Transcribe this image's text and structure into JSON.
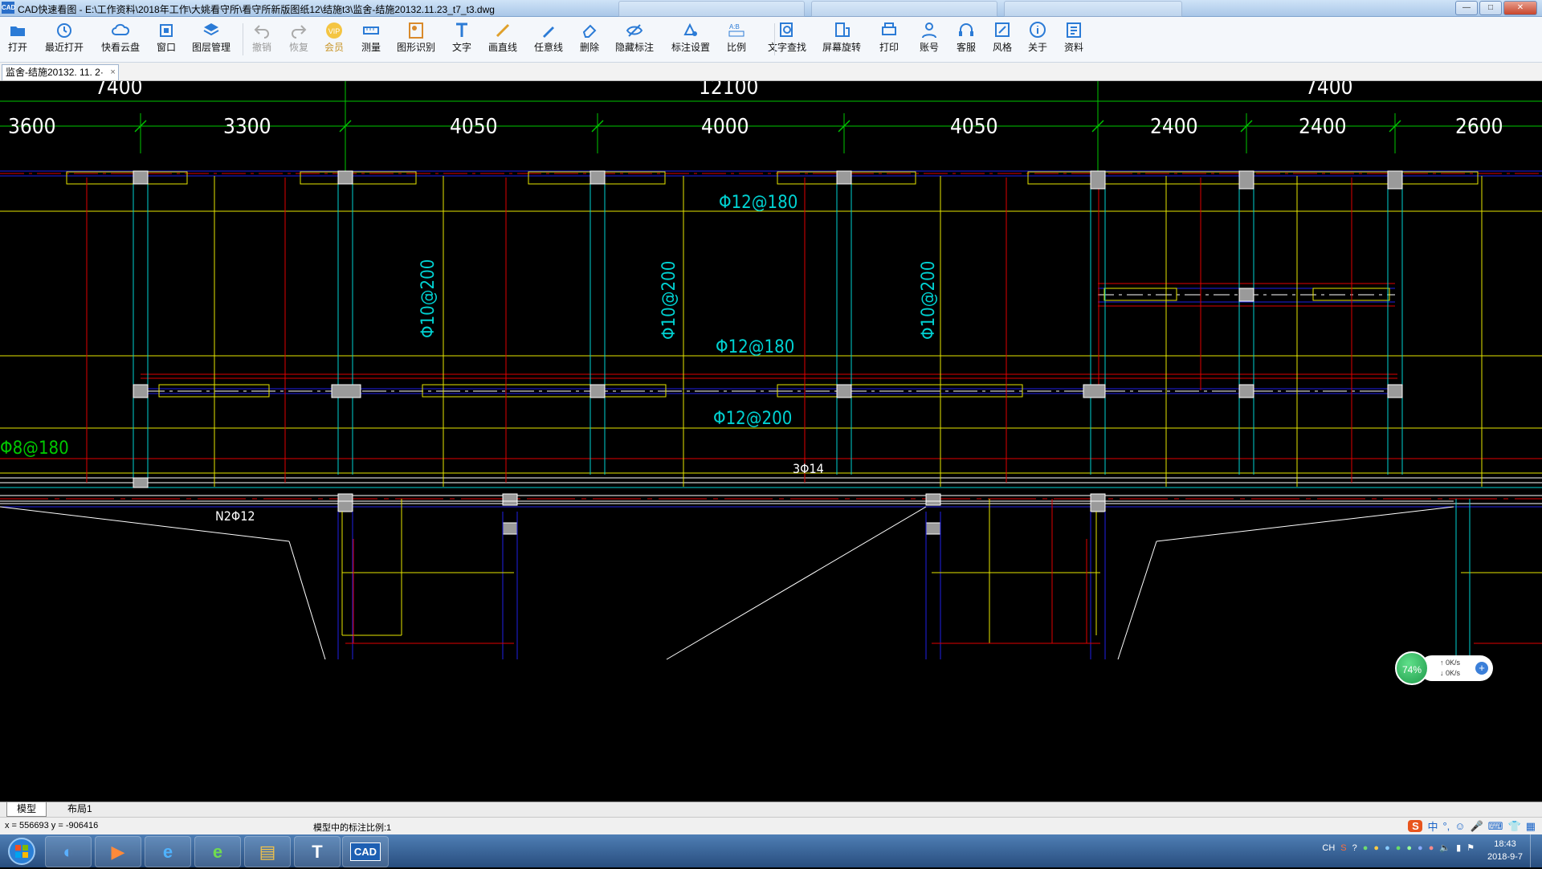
{
  "window": {
    "app_icon": "CAD",
    "title": "CAD快速看图 - E:\\工作资料\\2018年工作\\大姚看守所\\看守所新版图纸12\\结施t3\\监舍-结施20132.11.23_t7_t3.dwg",
    "buttons": [
      "minimize",
      "maximize",
      "close"
    ]
  },
  "toolbar": {
    "items": [
      {
        "label": "打开",
        "icon": "folder-open-icon"
      },
      {
        "label": "最近打开",
        "icon": "history-icon"
      },
      {
        "label": "快看云盘",
        "icon": "cloud-icon"
      },
      {
        "label": "窗口",
        "icon": "window-icon"
      },
      {
        "label": "图层管理",
        "icon": "layers-icon"
      },
      {
        "label": "撤销",
        "icon": "undo-icon",
        "disabled": true
      },
      {
        "label": "恢复",
        "icon": "redo-icon",
        "disabled": true
      },
      {
        "label": "会员",
        "icon": "vip-icon",
        "vip": true
      },
      {
        "label": "测量",
        "icon": "ruler-icon"
      },
      {
        "label": "图形识别",
        "icon": "shape-recognize-icon"
      },
      {
        "label": "文字",
        "icon": "text-icon"
      },
      {
        "label": "画直线",
        "icon": "line-icon"
      },
      {
        "label": "任意线",
        "icon": "freehand-icon"
      },
      {
        "label": "删除",
        "icon": "eraser-icon"
      },
      {
        "label": "隐藏标注",
        "icon": "hide-annotation-icon"
      },
      {
        "label": "标注设置",
        "icon": "annotation-settings-icon"
      },
      {
        "label": "比例",
        "icon": "scale-icon"
      },
      {
        "label": "文字查找",
        "icon": "text-search-icon"
      },
      {
        "label": "屏幕旋转",
        "icon": "rotate-screen-icon"
      },
      {
        "label": "打印",
        "icon": "printer-icon"
      },
      {
        "label": "账号",
        "icon": "account-icon"
      },
      {
        "label": "客服",
        "icon": "headset-icon"
      },
      {
        "label": "风格",
        "icon": "style-icon"
      },
      {
        "label": "关于",
        "icon": "info-icon"
      },
      {
        "label": "资料",
        "icon": "library-icon"
      }
    ]
  },
  "document_tab": {
    "label": "监舍-结施20132. 11. 2·",
    "close": "×"
  },
  "drawing": {
    "top_dims": [
      "7400",
      "12100",
      "7400"
    ],
    "second_dims": [
      "3600",
      "3300",
      "4050",
      "4000",
      "4050",
      "2400",
      "2400",
      "2600"
    ],
    "rebar_labels": [
      "Φ12@180",
      "Φ10@200",
      "Φ10@200",
      "Φ10@200",
      "Φ12@180",
      "Φ12@200",
      "Φ8@180",
      "3Φ14",
      "N2Φ12"
    ],
    "colors": {
      "background": "#000000",
      "dim": "#00c800",
      "cyan": "#00d2d2",
      "yellow": "#e6e600",
      "red": "#e00000",
      "blue": "#2020e6",
      "white": "#ffffff"
    }
  },
  "network_widget": {
    "percent": "74%",
    "up": "0K/s",
    "down": "0K/s",
    "plus": "+"
  },
  "layout_tabs": [
    "模型",
    "布局1"
  ],
  "status": {
    "coords": "x = 556693  y = -906416",
    "scale": "模型中的标注比例:1"
  },
  "ime": {
    "logo": "S",
    "lang": "中",
    "punct": "°,"
  },
  "taskbar": {
    "apps": [
      "browser-app-icon",
      "media-player-icon",
      "ie-icon",
      "360-browser-icon",
      "file-explorer-icon",
      "t-app-icon",
      "cad-app-icon"
    ],
    "cad_label": "CAD",
    "tray_lang": "CH",
    "clock_time": "18:43",
    "clock_date": "2018-9-7"
  }
}
